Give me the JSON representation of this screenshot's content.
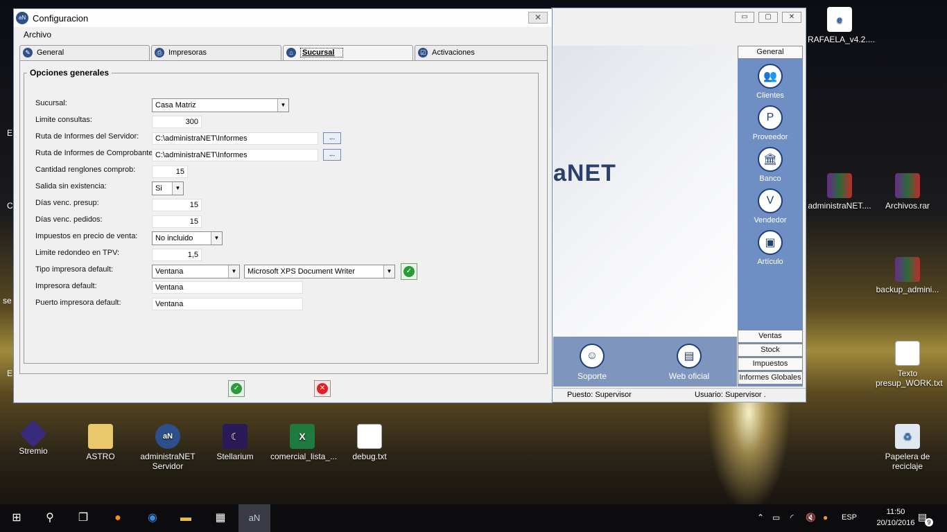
{
  "desktop": {
    "icons_right": [
      {
        "label": "RAFAELA_v4.2...."
      },
      {
        "label": "administraNET...."
      },
      {
        "label": "Archivos.rar"
      },
      {
        "label": "backup_admini..."
      },
      {
        "label": "Texto presup_WORK.txt"
      },
      {
        "label": "Papelera de reciclaje"
      }
    ],
    "icons_bottom": [
      {
        "label": "Stremio"
      },
      {
        "label": "ASTRO"
      },
      {
        "label": "administraNET Servidor"
      },
      {
        "label": "Stellarium"
      },
      {
        "label": "comercial_lista_..."
      },
      {
        "label": "debug.txt"
      }
    ],
    "left_edge": [
      "E",
      "C",
      "se",
      "E"
    ]
  },
  "main_window": {
    "logo_text": "aNET",
    "side_top_button": "General",
    "side_items": [
      "Clientes",
      "Proveedor",
      "Banco",
      "Vendedor",
      "Artículo"
    ],
    "side_bottom_buttons": [
      "Ventas",
      "Stock",
      "Impuestos",
      "Informes Globales"
    ],
    "bottom_items": [
      "Soporte",
      "Web oficial"
    ],
    "status": {
      "puesto": "Puesto: Supervisor",
      "usuario": "Usuario: Supervisor ."
    }
  },
  "dialog": {
    "title": "Configuracion",
    "menu": {
      "archivo": "Archivo"
    },
    "tabs": [
      "General",
      "Impresoras",
      "Sucursal",
      "Activaciones"
    ],
    "active_tab": "Sucursal",
    "group_title": "Opciones generales",
    "fields": {
      "sucursal": {
        "label": "Sucursal:",
        "value": "Casa Matriz"
      },
      "limite_consultas": {
        "label": "Limite consultas:",
        "value": "300"
      },
      "ruta_servidor": {
        "label": "Ruta de Informes del Servidor:",
        "value": "C:\\administraNET\\Informes"
      },
      "ruta_comprobantes": {
        "label": "Ruta de Informes de Comprobantes:",
        "value": "C:\\administraNET\\Informes"
      },
      "renglones": {
        "label": "Cantidad renglones comprob:",
        "value": "15"
      },
      "salida": {
        "label": "Salida sin existencia:",
        "value": "Si"
      },
      "venc_presup": {
        "label": "Días venc. presup:",
        "value": "15"
      },
      "venc_pedidos": {
        "label": "Días venc. pedidos:",
        "value": "15"
      },
      "impuestos": {
        "label": "Impuestos en precio de venta:",
        "value": "No incluido"
      },
      "redondeo": {
        "label": "Limite redondeo en TPV:",
        "value": "1,5"
      },
      "tipo_impresora": {
        "label": "Tipo impresora default:",
        "value": "Ventana",
        "printer": "Microsoft XPS Document Writer"
      },
      "impresora": {
        "label": "Impresora default:",
        "value": "Ventana"
      },
      "puerto": {
        "label": "Puerto impresora default:",
        "value": "Ventana"
      }
    },
    "browse_label": "..."
  },
  "taskbar": {
    "lang": "ESP",
    "time": "11:50",
    "date": "20/10/2016",
    "notifications": "9"
  }
}
